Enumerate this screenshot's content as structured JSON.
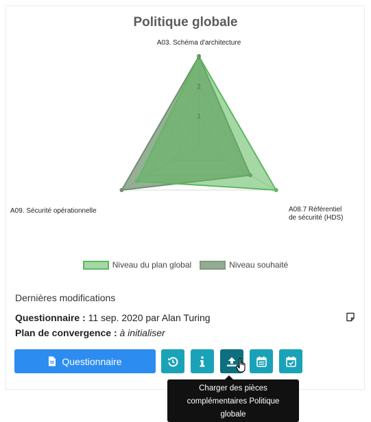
{
  "chart_data": {
    "type": "radar",
    "title": "Politique globale",
    "axes": [
      "A03. Schéma d'architecture",
      "A08.7 Référentiel",
      "A09. Sécurité opérationnelle"
    ],
    "axis_label_lines": {
      "top": [
        "A03. Schéma d'architecture"
      ],
      "right": [
        "A08.7 Référentiel",
        "de sécurité (HDS)"
      ],
      "left": [
        "A09. Sécurité opérationnelle"
      ]
    },
    "r_ticks": [
      "1",
      "2",
      "3"
    ],
    "r_range": [
      0,
      3
    ],
    "series": [
      {
        "name": "Niveau du plan global",
        "values": [
          3,
          3,
          2.4
        ],
        "color": "#5cb85c"
      },
      {
        "name": "Niveau souhaité",
        "values": [
          3,
          2,
          3
        ],
        "color": "#6f8f6f"
      }
    ],
    "legend_position": "bottom"
  },
  "modifications": {
    "heading": "Dernières modifications",
    "questionnaire_label": "Questionnaire :",
    "questionnaire_value": "11 sep. 2020 par Alan Turing",
    "convergence_label": "Plan de convergence :",
    "convergence_value": "à initialiser"
  },
  "buttons": {
    "questionnaire_label": "Questionnaire"
  },
  "tooltip": {
    "lines": [
      "Charger des pièces",
      "complémentaires Politique",
      "globale"
    ]
  },
  "colors": {
    "primary": "#2d8cf0",
    "info": "#1aa2b8",
    "plan_fill": "#5cb85c",
    "souhaite_fill": "#6f8f6f"
  }
}
